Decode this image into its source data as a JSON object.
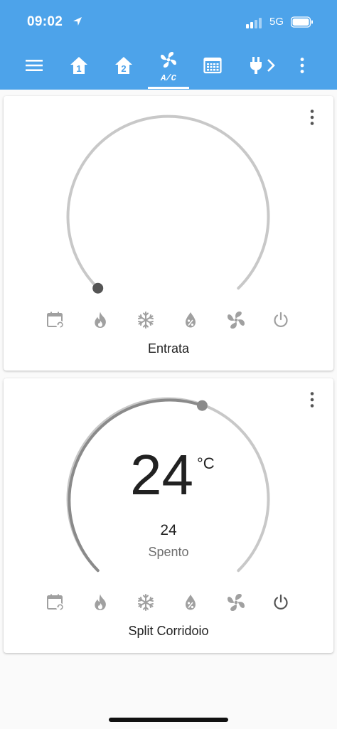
{
  "status_bar": {
    "time": "09:02",
    "network": "5G"
  },
  "toolbar": {
    "icons": [
      "menu-icon",
      "home-1-icon",
      "home-2-icon",
      "fan-ac-icon",
      "calendar-icon",
      "plug-icon",
      "chevron-right-icon",
      "more-vert-icon"
    ],
    "active_tab": "A/C",
    "tab_home1": "1",
    "tab_home2": "2",
    "tab_ac": "A/C"
  },
  "cards": [
    {
      "name": "Entrata",
      "temperature": "",
      "unit": "",
      "setpoint": "",
      "state": "",
      "modes": [
        "schedule-icon",
        "flame-icon",
        "snowflake-icon",
        "water-percent-icon",
        "fan-icon",
        "power-icon"
      ]
    },
    {
      "name": "Split Corridoio",
      "temperature": "24",
      "unit": "°C",
      "setpoint": "24",
      "state": "Spento",
      "modes": [
        "schedule-icon",
        "flame-icon",
        "snowflake-icon",
        "water-percent-icon",
        "fan-icon",
        "power-icon"
      ]
    }
  ],
  "colors": {
    "header": "#4da3ea",
    "icon_grey": "#a0a0a0",
    "dial_track": "#c8c8c8",
    "dial_active": "#8a8a8a"
  }
}
